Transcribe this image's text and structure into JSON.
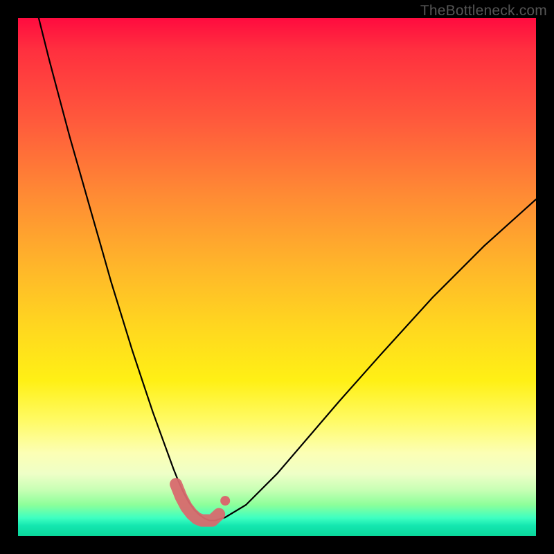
{
  "watermark": "TheBottleneck.com",
  "colors": {
    "curve_stroke": "#000000",
    "marker_stroke": "#d86a6e",
    "marker_fill": "#d86a6e"
  },
  "chart_data": {
    "type": "line",
    "title": "",
    "xlabel": "",
    "ylabel": "",
    "xlim": [
      0,
      100
    ],
    "ylim": [
      0,
      100
    ],
    "series": [
      {
        "name": "bottleneck-curve",
        "x": [
          4,
          6,
          8,
          10,
          12,
          14,
          16,
          18,
          20,
          22,
          24,
          26,
          28,
          30,
          31,
          32,
          33,
          34,
          35,
          36,
          37,
          38,
          40,
          44,
          50,
          56,
          62,
          70,
          80,
          90,
          100
        ],
        "y": [
          100,
          92,
          84.5,
          77,
          70,
          63,
          56,
          49,
          42.5,
          36,
          30,
          24,
          18.5,
          13,
          10.5,
          8.3,
          6.5,
          5.1,
          4.1,
          3.4,
          3.0,
          3.0,
          3.6,
          6.0,
          12,
          19,
          26,
          35,
          46,
          56,
          65
        ]
      }
    ],
    "markers": {
      "name": "highlight-band",
      "x": [
        30.5,
        31.5,
        32.5,
        33.5,
        34.5,
        35.5,
        36.5,
        37.5,
        38.8
      ],
      "y": [
        10.0,
        7.5,
        5.6,
        4.3,
        3.4,
        3.0,
        3.0,
        3.0,
        4.2
      ]
    }
  }
}
